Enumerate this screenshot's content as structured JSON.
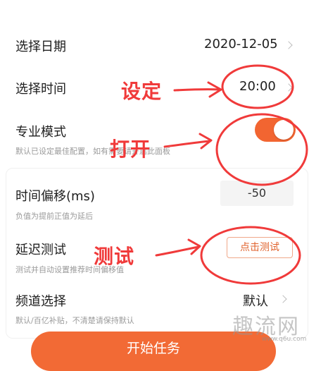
{
  "rows": {
    "date": {
      "label": "选择日期",
      "value": "2020-12-05"
    },
    "time": {
      "label": "选择时间",
      "value": "20:00"
    },
    "pro_mode": {
      "label": "专业模式",
      "sub": "默认已设定最佳配置，如有需要请开启此面板",
      "enabled": true
    },
    "offset": {
      "label": "时间偏移(ms)",
      "value": "-50",
      "sub": "负值为提前正值为延后"
    },
    "delay_test": {
      "label": "延迟测试",
      "button": "点击测试",
      "sub": "测试并自动设置推荐时间偏移值"
    },
    "channel": {
      "label": "频道选择",
      "value": "默认",
      "sub": "默认/百亿补贴，不清楚请保持默认"
    }
  },
  "start_button": "开始任务",
  "annotations": {
    "set": "设定",
    "open": "打开",
    "test": "测试"
  },
  "watermark": {
    "main": "趣流网",
    "sub": "www.q6u.com"
  },
  "colors": {
    "accent": "#f26531",
    "annotation": "#f03a3a"
  }
}
